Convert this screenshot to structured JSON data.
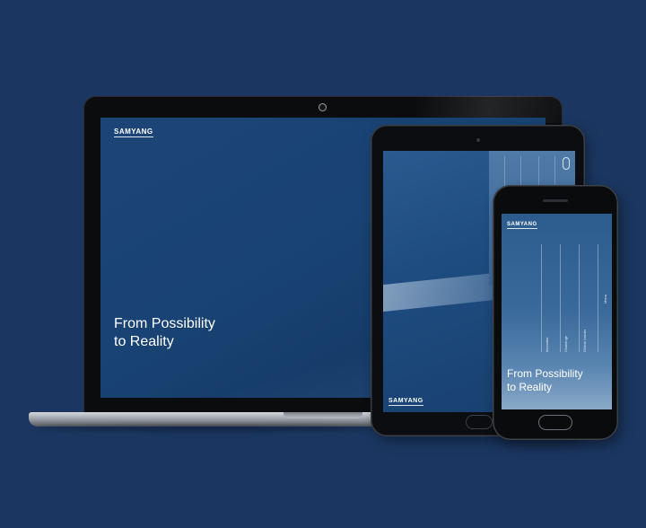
{
  "laptop": {
    "logo": "SAMYANG",
    "headline_line1": "From Possibility",
    "headline_line2": "to Reality"
  },
  "tablet": {
    "logo": "SAMYANG"
  },
  "phone": {
    "logo": "SAMYANG",
    "menu_label": "Menu",
    "nav_items": [
      "Innovator",
      "Challenge",
      "Global Leader"
    ],
    "headline_line1": "From Possibility",
    "headline_line2": "to Reality"
  },
  "colors": {
    "background": "#1b3761",
    "screen_blue": "#1d4476"
  }
}
